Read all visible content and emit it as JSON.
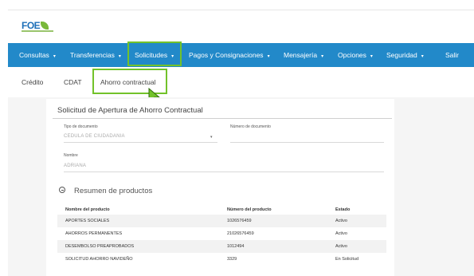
{
  "brand": {
    "name": "FOE"
  },
  "nav": {
    "items": [
      {
        "label": "Consultas"
      },
      {
        "label": "Transferencias"
      },
      {
        "label": "Solicitudes"
      },
      {
        "label": "Pagos y Consignaciones"
      },
      {
        "label": "Mensajería"
      },
      {
        "label": "Opciones"
      },
      {
        "label": "Seguridad"
      },
      {
        "label": "Salir"
      }
    ],
    "caret": "▾",
    "highlighted": "Solicitudes"
  },
  "subnav": {
    "items": [
      {
        "label": "Crédito"
      },
      {
        "label": "CDAT"
      },
      {
        "label": "Ahorro contractual"
      }
    ],
    "highlighted": "Ahorro contractual"
  },
  "form": {
    "title": "Solicitud de Apertura de Ahorro Contractual",
    "tipo_documento_label": "Tipo de documento",
    "tipo_documento_value": "CEDULA DE CIUDADANIA",
    "numero_documento_label": "Número de documento",
    "numero_documento_value": "",
    "nombre_label": "Nombre",
    "nombre_value": "ADRIANA"
  },
  "summary": {
    "title": "Resumen de productos",
    "columns": [
      "Nombre del producto",
      "Número del producto",
      "Estado"
    ],
    "rows": [
      [
        "APORTES SOCIALES",
        "1026576459",
        "Activo"
      ],
      [
        "AHORROS PERMANENTES",
        "21026576459",
        "Activo"
      ],
      [
        "DESEMBOLSO PREAPROBADOS",
        "1012494",
        "Activo"
      ],
      [
        "SOLICITUD AHORRO NAVIDEÑO",
        "3329",
        "En Solicitud"
      ]
    ]
  },
  "colors": {
    "navbar": "#2289c9",
    "highlight": "#72c22a",
    "brand_blue": "#1d6fb8",
    "brand_green": "#79b83a"
  }
}
